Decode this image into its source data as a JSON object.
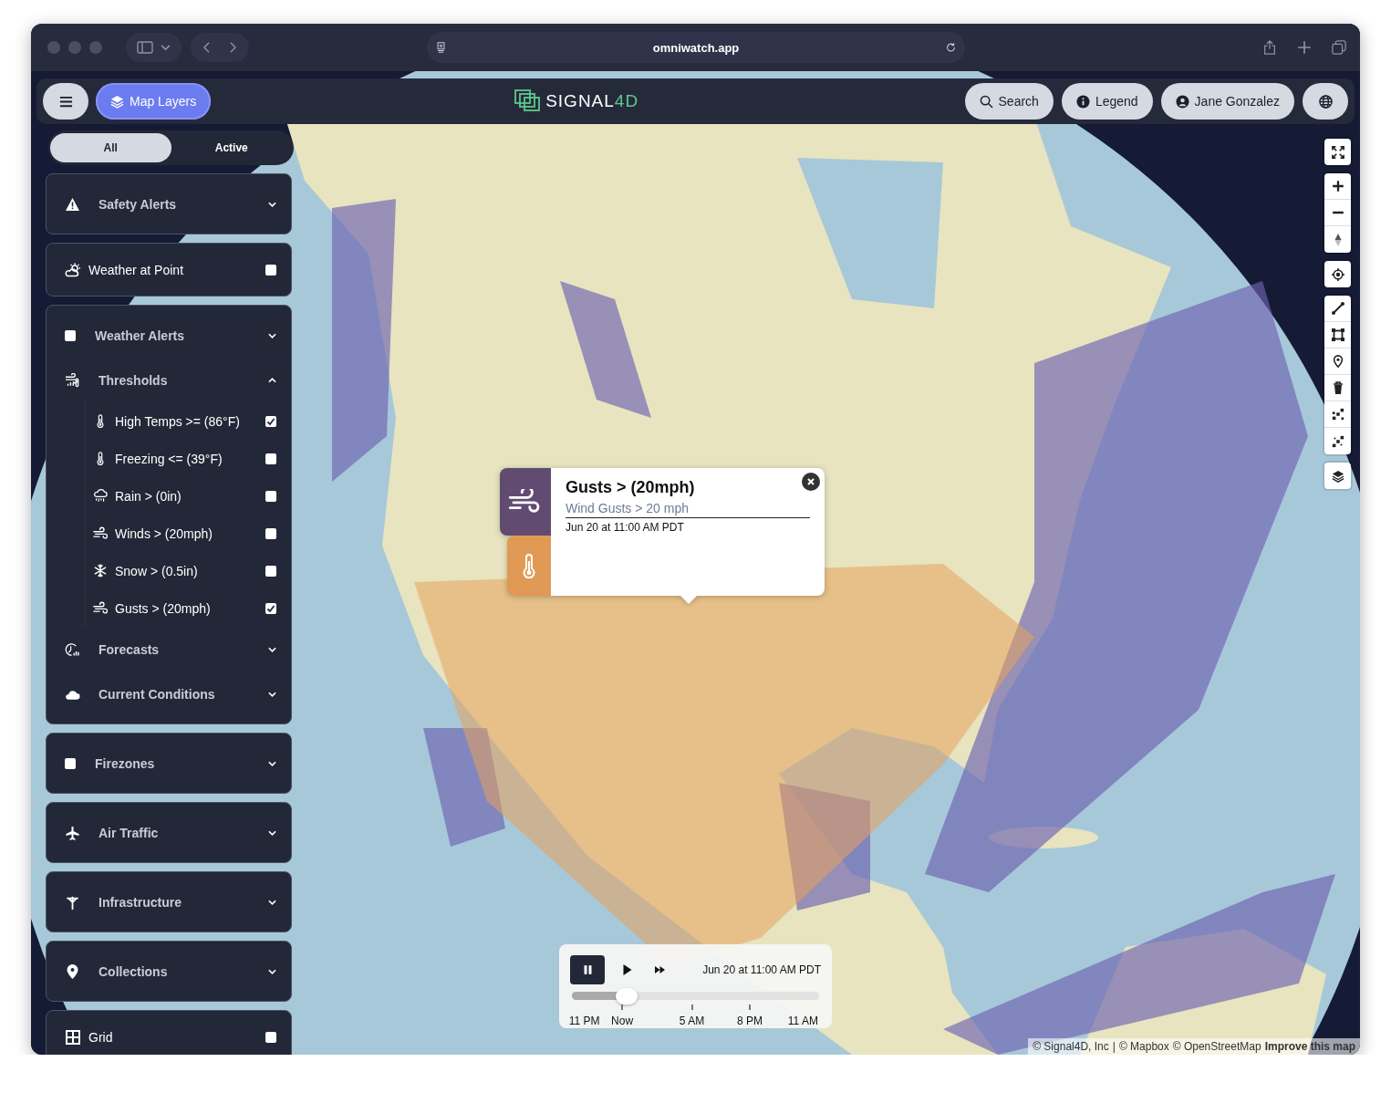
{
  "browser": {
    "url": "omniwatch.app"
  },
  "header": {
    "layers_button": {
      "label": "Map Layers",
      "selected": true
    },
    "logo": {
      "text": "SIGNAL",
      "accent": "4D"
    },
    "buttons": [
      {
        "kind": "search",
        "label": "Search"
      },
      {
        "kind": "legend",
        "label": "Legend"
      },
      {
        "kind": "user",
        "label": "Jane Gonzalez"
      },
      {
        "kind": "globe"
      }
    ]
  },
  "sidebar": {
    "filter_tabs": [
      {
        "label": "All",
        "selected": true
      },
      {
        "label": "Active",
        "selected": false
      }
    ],
    "panels": [
      {
        "items": [
          {
            "kind": "group",
            "label": "Safety Alerts",
            "expanded": false
          }
        ]
      },
      {
        "items": [
          {
            "kind": "toggle",
            "label": "Weather at Point",
            "checked": false
          }
        ]
      },
      {
        "items": [
          {
            "kind": "check_group",
            "label": "Weather Alerts",
            "checked": false,
            "expanded": false
          },
          {
            "kind": "group",
            "label": "Thresholds",
            "expanded": true,
            "children": [
              {
                "label": "High Temps >= (86°F)",
                "checked": true
              },
              {
                "label": "Freezing <= (39°F)",
                "checked": false
              },
              {
                "label": "Rain > (0in)",
                "checked": false
              },
              {
                "label": "Winds > (20mph)",
                "checked": false
              },
              {
                "label": "Snow > (0.5in)",
                "checked": false
              },
              {
                "label": "Gusts > (20mph)",
                "checked": true
              }
            ]
          },
          {
            "kind": "group",
            "label": "Forecasts",
            "expanded": false
          },
          {
            "kind": "group",
            "label": "Current Conditions",
            "expanded": false
          }
        ]
      },
      {
        "items": [
          {
            "kind": "check_group",
            "label": "Firezones",
            "checked": false,
            "expanded": false
          }
        ]
      },
      {
        "items": [
          {
            "kind": "group",
            "label": "Air Traffic",
            "expanded": false
          }
        ]
      },
      {
        "items": [
          {
            "kind": "group",
            "label": "Infrastructure",
            "expanded": false
          }
        ]
      },
      {
        "items": [
          {
            "kind": "group",
            "label": "Collections",
            "expanded": false
          }
        ]
      },
      {
        "items": [
          {
            "kind": "toggle",
            "label": "Grid",
            "checked": false
          }
        ]
      }
    ]
  },
  "popup": {
    "tabs": [
      {
        "selected": true,
        "color": "#614b70"
      },
      {
        "selected": false,
        "color": "#e09a55"
      }
    ],
    "title": "Gusts > (20mph)",
    "subtitle": "Wind Gusts > 20 mph",
    "time": "Jun 20 at 11:00 AM PDT"
  },
  "timeline": {
    "controls": [
      {
        "kind": "pause",
        "selected": true
      },
      {
        "kind": "play",
        "selected": false
      },
      {
        "kind": "fast_forward",
        "selected": false
      }
    ],
    "time": "Jun 20 at 11:00 AM PDT",
    "level": 0.22,
    "ticks": [
      {
        "label": "11 PM",
        "marked": false
      },
      {
        "label": "Now",
        "marked": true
      },
      {
        "label": "5 AM",
        "marked": true
      },
      {
        "label": "8 PM",
        "marked": true
      },
      {
        "label": "11 AM",
        "marked": false
      }
    ]
  },
  "attribution": {
    "texts": [
      "© Signal4D, Inc",
      "|",
      "© Mapbox",
      "© OpenStreetMap"
    ],
    "link": "Improve this map"
  }
}
